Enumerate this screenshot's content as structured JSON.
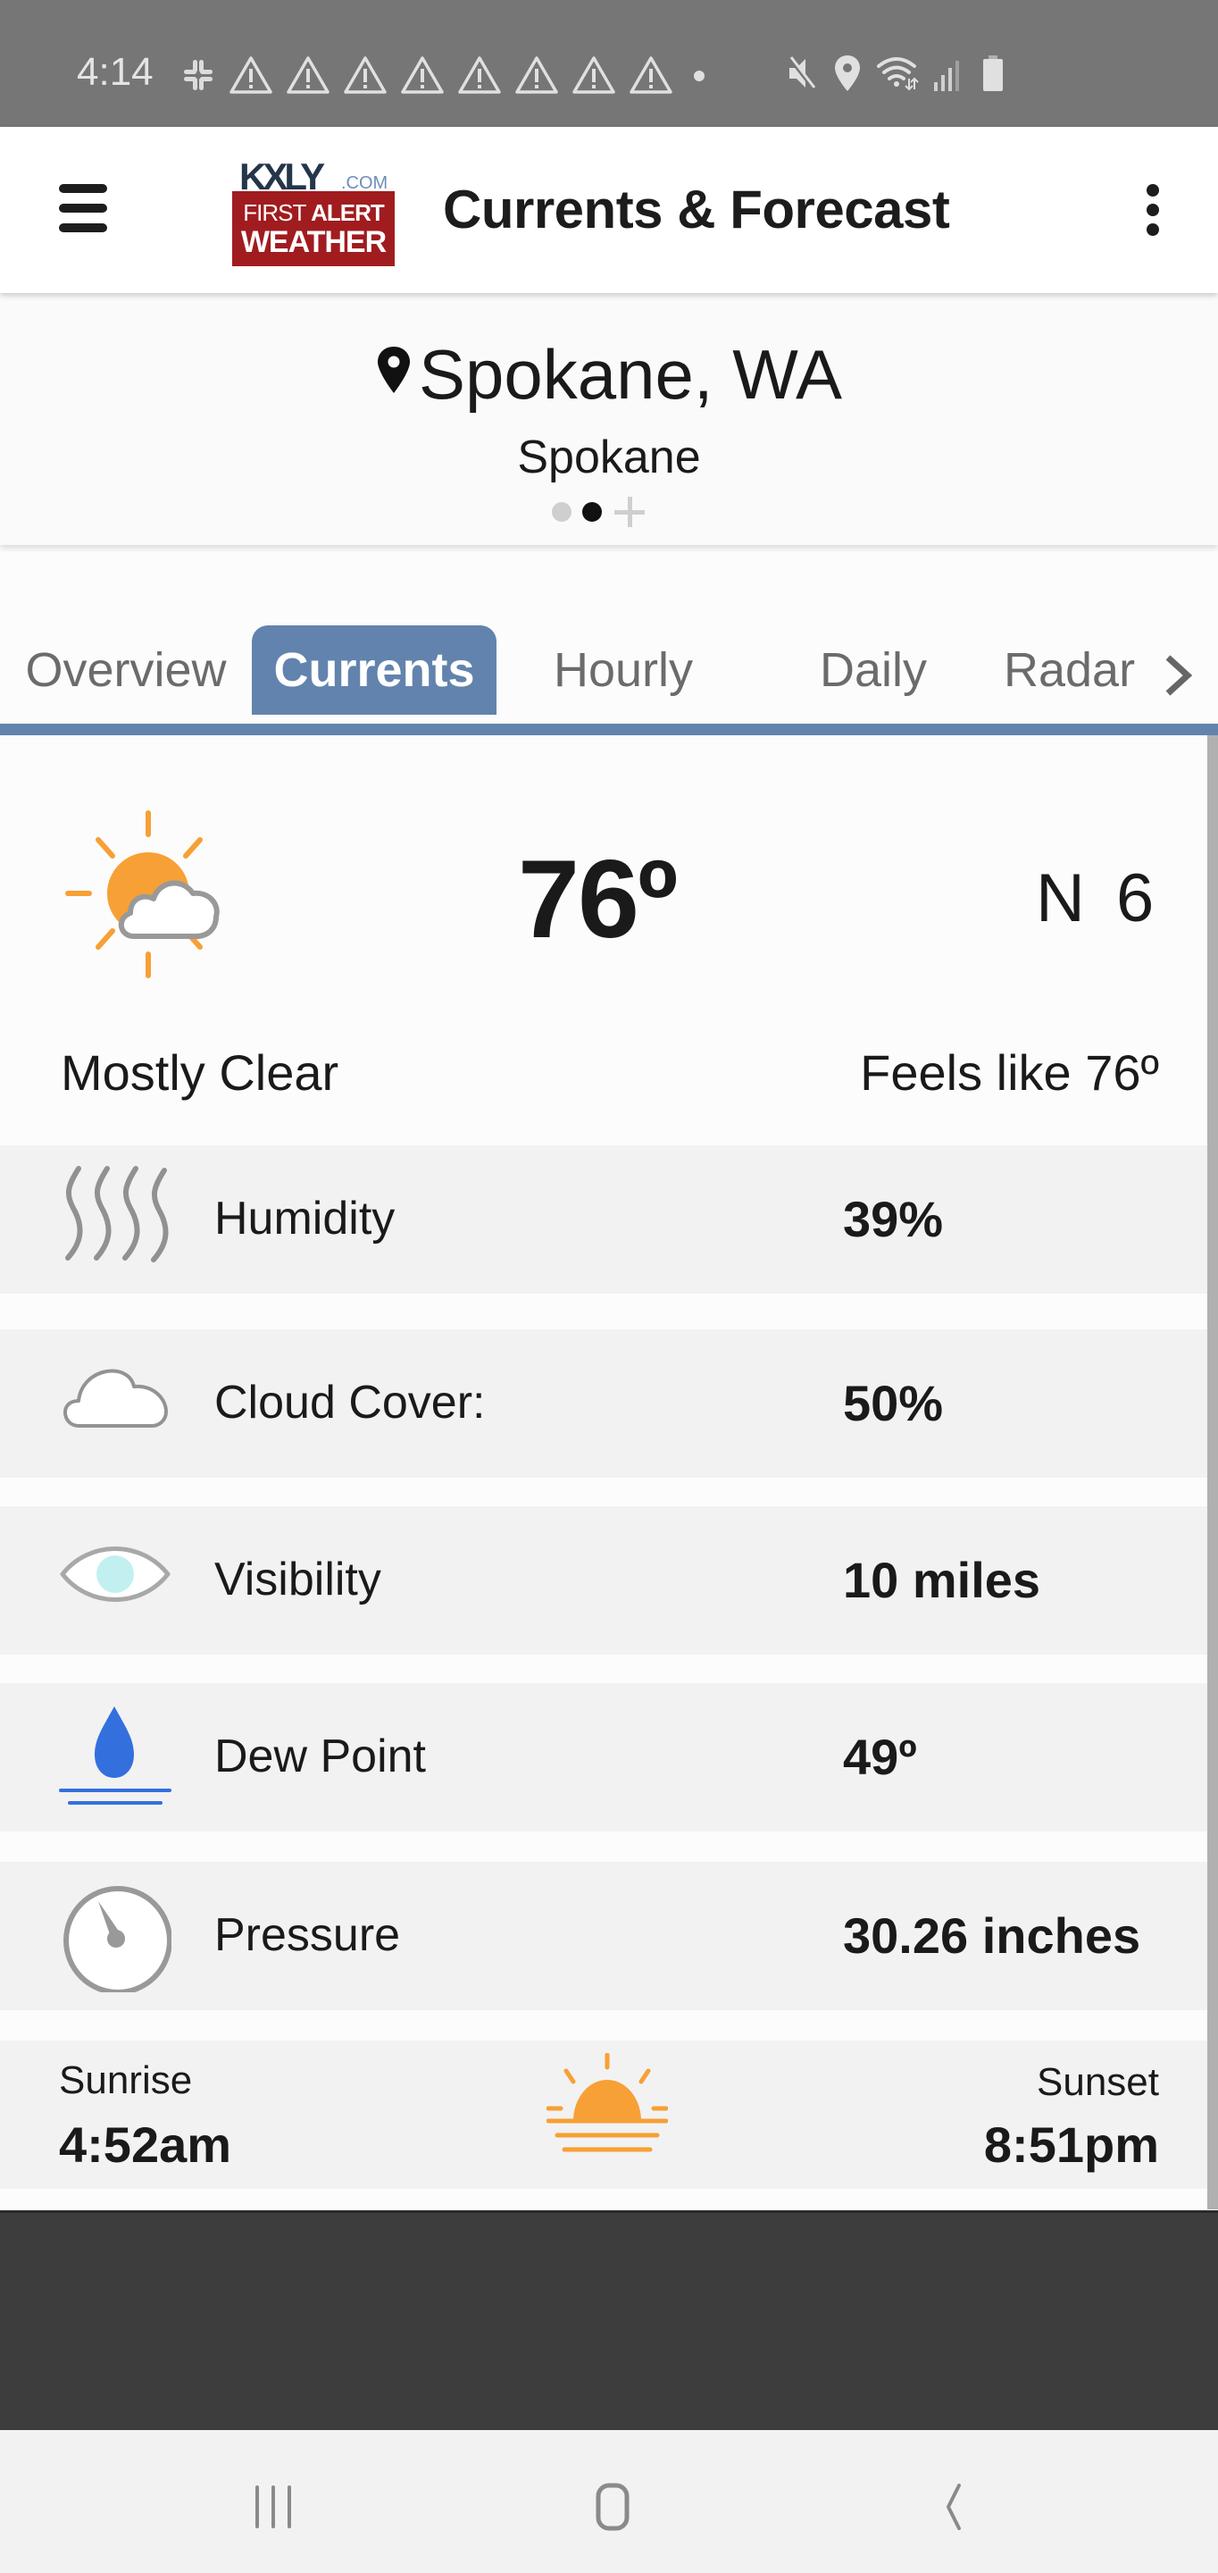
{
  "status_bar": {
    "time": "4:14",
    "left_icons": [
      "slack-icon",
      "warning-icon",
      "warning-icon",
      "warning-icon",
      "warning-icon",
      "warning-icon",
      "warning-icon",
      "warning-icon",
      "warning-icon",
      "dot-icon"
    ],
    "right_icons": [
      "mute-icon",
      "location-icon",
      "wifi-icon",
      "signal-icon",
      "battery-icon"
    ]
  },
  "app_bar": {
    "title": "Currents & Forecast",
    "logo": {
      "brand": "KXLY",
      "domain": ".COM",
      "line1_a": "FIRST",
      "line1_b": "ALERT",
      "line2": "WEATHER"
    },
    "colors": {
      "logo_red": "#a01c1f",
      "logo_navy": "#25354a"
    }
  },
  "location": {
    "title": "Spokane, WA",
    "subtitle": "Spokane",
    "pager": {
      "pages": 2,
      "active_index": 1,
      "add_label": "+"
    }
  },
  "tabs": {
    "items": [
      {
        "label": "Overview",
        "active": false
      },
      {
        "label": "Currents",
        "active": true
      },
      {
        "label": "Hourly",
        "active": false
      },
      {
        "label": "Daily",
        "active": false
      },
      {
        "label": "Radar",
        "active": false
      }
    ],
    "accent_color": "#6283ad"
  },
  "current": {
    "icon": "partly-cloudy-icon",
    "temperature": "76º",
    "wind": "N 6",
    "condition": "Mostly Clear",
    "feels_like": "Feels like 76º"
  },
  "details": [
    {
      "icon": "humidity-icon",
      "label": "Humidity",
      "value": "39%"
    },
    {
      "icon": "cloud-icon",
      "label": "Cloud Cover:",
      "value": "50%"
    },
    {
      "icon": "eye-icon",
      "label": "Visibility",
      "value": "10 miles"
    },
    {
      "icon": "dew-point-icon",
      "label": "Dew Point",
      "value": "49º"
    },
    {
      "icon": "pressure-gauge-icon",
      "label": "Pressure",
      "value": "30.26 inches"
    }
  ],
  "sun": {
    "sunrise_label": "Sunrise",
    "sunrise_time": "4:52am",
    "sunset_label": "Sunset",
    "sunset_time": "8:51pm"
  },
  "nav_bar": {
    "buttons": [
      "recent-apps",
      "home",
      "back"
    ]
  }
}
